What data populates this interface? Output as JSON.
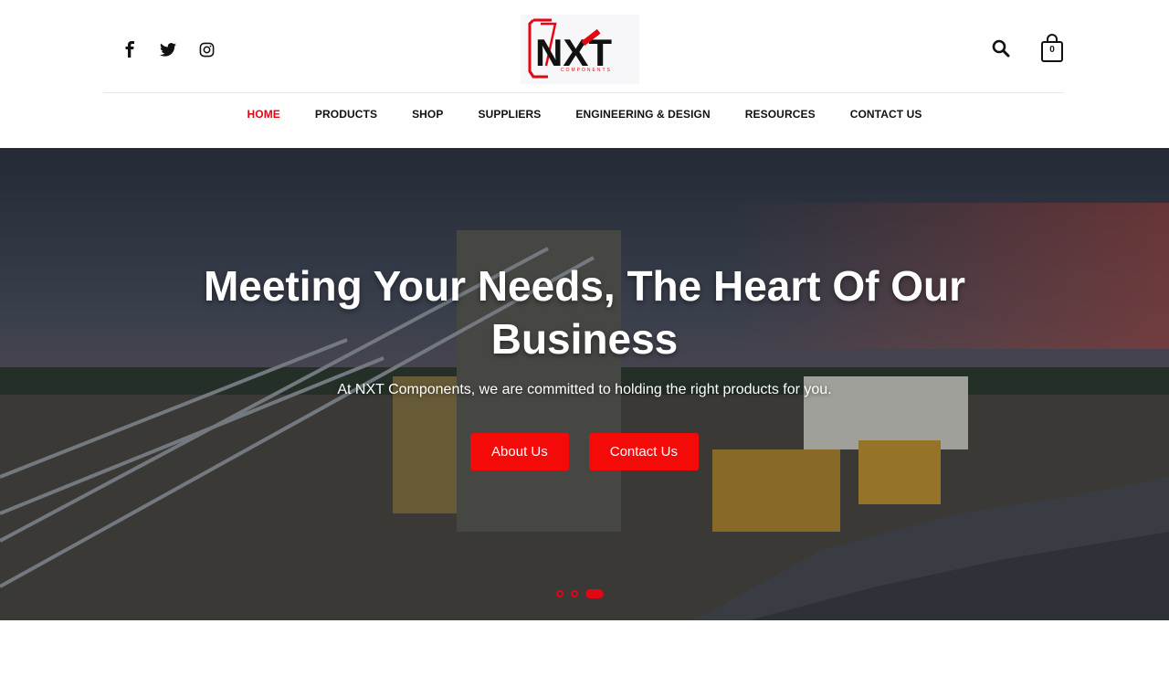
{
  "brand": {
    "logo_text": "NXT",
    "logo_subtext": "COMPONENTS",
    "accent_color": "#e30613"
  },
  "header": {
    "social": [
      {
        "name": "facebook",
        "icon": "facebook-icon"
      },
      {
        "name": "twitter",
        "icon": "twitter-icon"
      },
      {
        "name": "instagram",
        "icon": "instagram-icon"
      }
    ],
    "cart_count": "0",
    "search_icon": "search-icon",
    "cart_icon": "shopping-bag-icon"
  },
  "nav": {
    "items": [
      {
        "label": "HOME",
        "active": true
      },
      {
        "label": "PRODUCTS",
        "active": false
      },
      {
        "label": "SHOP",
        "active": false
      },
      {
        "label": "SUPPLIERS",
        "active": false
      },
      {
        "label": "ENGINEERING & DESIGN",
        "active": false
      },
      {
        "label": "RESOURCES",
        "active": false
      },
      {
        "label": "CONTACT US",
        "active": false
      }
    ]
  },
  "hero": {
    "title": "Meeting Your Needs, The Heart Of Our Business",
    "subtitle": "At NXT Components, we are committed to holding the right products for you.",
    "buttons": {
      "about": "About Us",
      "contact": "Contact Us"
    },
    "slides_total": 3,
    "slide_active": 3
  }
}
